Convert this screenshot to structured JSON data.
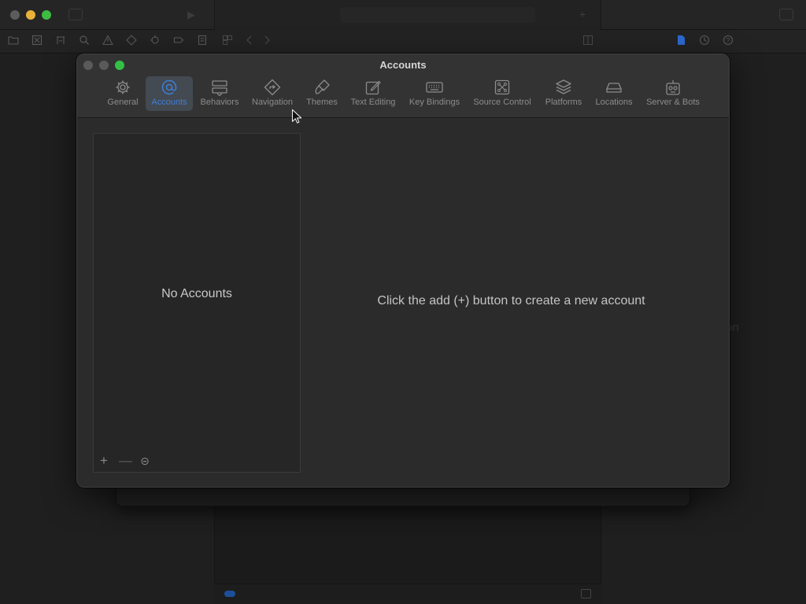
{
  "settings_window": {
    "title": "Accounts",
    "tabs": [
      {
        "label": "General",
        "icon": "gear-icon"
      },
      {
        "label": "Accounts",
        "icon": "at-sign-icon",
        "selected": true
      },
      {
        "label": "Behaviors",
        "icon": "behaviors-icon"
      },
      {
        "label": "Navigation",
        "icon": "navigation-icon"
      },
      {
        "label": "Themes",
        "icon": "paintbrush-icon"
      },
      {
        "label": "Text Editing",
        "icon": "text-edit-icon"
      },
      {
        "label": "Key Bindings",
        "icon": "keyboard-icon"
      },
      {
        "label": "Source Control",
        "icon": "source-control-icon"
      },
      {
        "label": "Platforms",
        "icon": "layers-icon"
      },
      {
        "label": "Locations",
        "icon": "drive-icon"
      },
      {
        "label": "Server & Bots",
        "icon": "robot-icon"
      }
    ],
    "accounts_list": {
      "empty_label": "No Accounts",
      "controls": {
        "add": "+",
        "remove": "—",
        "options": "⊝"
      }
    },
    "detail": {
      "message": "Click the add (+) button to create a new account"
    }
  },
  "background_window": {
    "inspector_text_fragment": "on"
  },
  "colors": {
    "accent": "#3d7fd9",
    "window_bg": "#2b2b2b",
    "zoom_button": "#32c145",
    "minimize_button": "#e8b23a"
  }
}
